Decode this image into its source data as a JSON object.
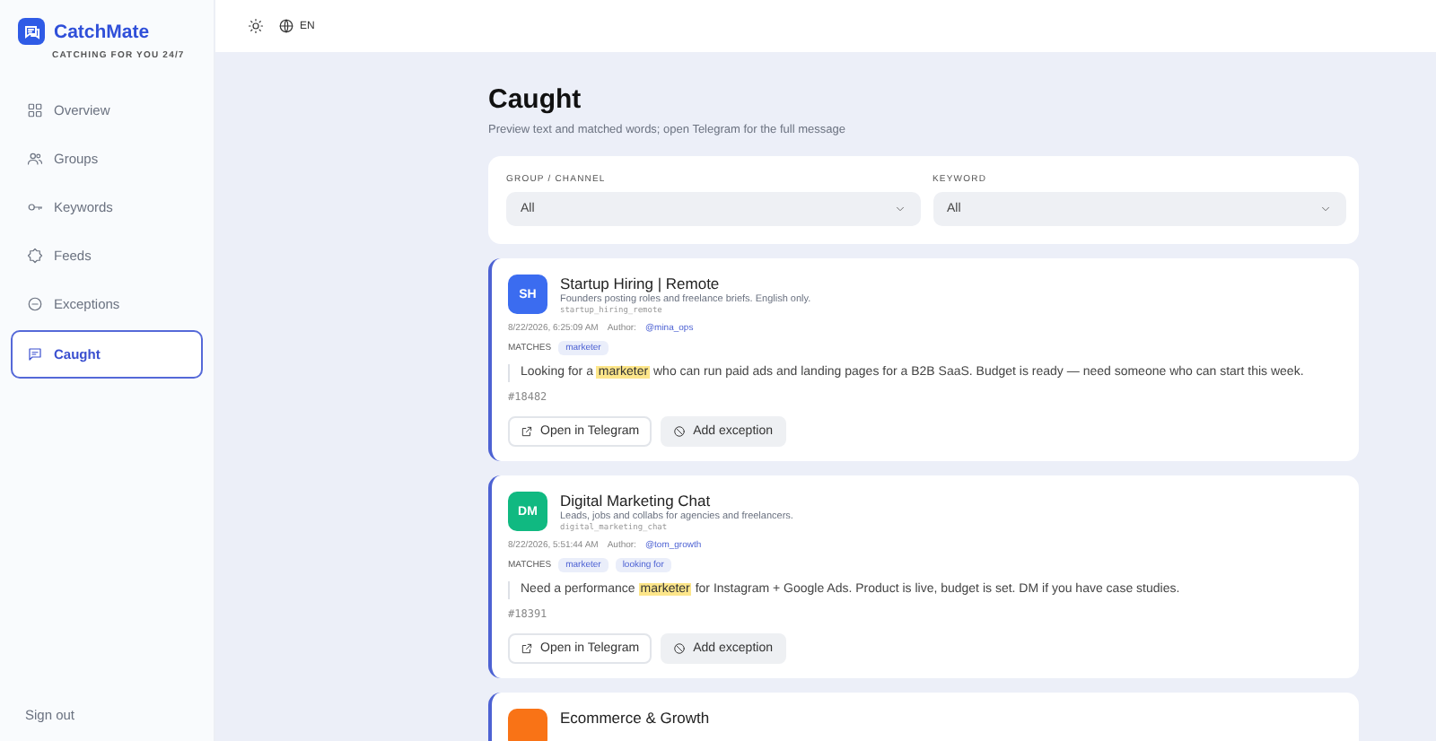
{
  "brand": {
    "name": "CatchMate",
    "tagline": "CATCHING FOR YOU 24/7"
  },
  "topbar": {
    "language": "EN"
  },
  "sidebar": {
    "items": [
      {
        "label": "Overview",
        "selected": false
      },
      {
        "label": "Groups",
        "selected": false
      },
      {
        "label": "Keywords",
        "selected": false
      },
      {
        "label": "Feeds",
        "selected": false
      },
      {
        "label": "Exceptions",
        "selected": false
      },
      {
        "label": "Caught",
        "selected": true
      }
    ],
    "sign_out": "Sign out"
  },
  "page": {
    "title": "Caught",
    "subtitle": "Preview text and matched words; open Telegram for the full message"
  },
  "filters": [
    {
      "label": "GROUP / CHANNEL",
      "value": "All"
    },
    {
      "label": "KEYWORD",
      "value": "All"
    }
  ],
  "messages": [
    {
      "initials": "SH",
      "color": "#3b6cf0",
      "name": "Startup Hiring | Remote",
      "description": "Founders posting roles and freelance briefs. English only.",
      "handle": "startup_hiring_remote",
      "time": "8/22/2026, 6:25:09 AM",
      "author_label": "Author:",
      "author": "@mina_ops",
      "matches_label": "MATCHES",
      "matches": [
        "marketer"
      ],
      "text": [
        {
          "text": "Looking for a ",
          "highlight": false
        },
        {
          "text": "marketer",
          "highlight": true
        },
        {
          "text": " who can run paid ads and landing pages for a B2B SaaS. Budget is ready — need someone who can start this week.",
          "highlight": false
        }
      ],
      "id": "#18482",
      "actions": [
        {
          "kind": "open",
          "label": "Open in Telegram"
        },
        {
          "kind": "exception",
          "label": "Add exception"
        }
      ]
    },
    {
      "initials": "DM",
      "color": "#10b981",
      "name": "Digital Marketing Chat",
      "description": "Leads, jobs and collabs for agencies and freelancers.",
      "handle": "digital_marketing_chat",
      "time": "8/22/2026, 5:51:44 AM",
      "author_label": "Author:",
      "author": "@tom_growth",
      "matches_label": "MATCHES",
      "matches": [
        "marketer",
        "looking for"
      ],
      "text": [
        {
          "text": "Need a performance ",
          "highlight": false
        },
        {
          "text": "marketer",
          "highlight": true
        },
        {
          "text": " for Instagram + Google Ads. Product is live, budget is set. DM if you have case studies.",
          "highlight": false
        }
      ],
      "id": "#18391",
      "actions": [
        {
          "kind": "open",
          "label": "Open in Telegram"
        },
        {
          "kind": "exception",
          "label": "Add exception"
        }
      ]
    },
    {
      "color": "#f97316",
      "name": "Ecommerce & Growth"
    }
  ]
}
